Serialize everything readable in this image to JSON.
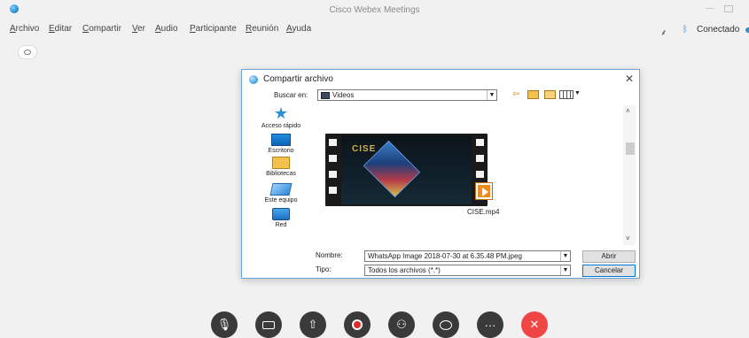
{
  "window": {
    "title": "Cisco Webex Meetings",
    "min_glyph": "—"
  },
  "menu": [
    "Archivo",
    "Editar",
    "Compartir",
    "Ver",
    "Audio",
    "Participante",
    "Reunión",
    "Ayuda"
  ],
  "status": {
    "text": "Conectado",
    "key_glyph": "⸙",
    "bt_glyph": "ᛒ"
  },
  "dialog": {
    "title": "Compartir archivo",
    "close_glyph": "✕",
    "look_in_label": "Buscar en:",
    "look_in_value": "Videos",
    "back_glyph": "⇦",
    "places": [
      {
        "label": "Acceso rápido",
        "icon": "star-icon"
      },
      {
        "label": "Escritorio",
        "icon": "desktop-icon"
      },
      {
        "label": "Bibliotecas",
        "icon": "libraries-icon"
      },
      {
        "label": "Este equipo",
        "icon": "computer-icon"
      },
      {
        "label": "Red",
        "icon": "network-icon"
      }
    ],
    "file": {
      "name": "CISE.mp4",
      "thumb_text": "CISE"
    },
    "name_label": "Nombre:",
    "name_value": "WhatsApp Image 2018-07-30 at 6.35.48 PM.jpeg",
    "type_label": "Tipo:",
    "type_value": "Todos los archivos (*.*)",
    "open_button": "Abrir",
    "cancel_button": "Cancelar"
  },
  "controls": [
    {
      "name": "mute-button",
      "glyph": "🎙"
    },
    {
      "name": "video-button",
      "glyph": ""
    },
    {
      "name": "share-button",
      "glyph": "⇧"
    },
    {
      "name": "record-button",
      "glyph": ""
    },
    {
      "name": "participants-button",
      "glyph": "⚇"
    },
    {
      "name": "chat-button",
      "glyph": ""
    },
    {
      "name": "more-button",
      "glyph": "···"
    },
    {
      "name": "end-meeting-button",
      "glyph": "✕"
    }
  ],
  "colors": {
    "accent": "#2a8fd8",
    "end": "#f04545",
    "control_bg": "#3a3a3a"
  }
}
